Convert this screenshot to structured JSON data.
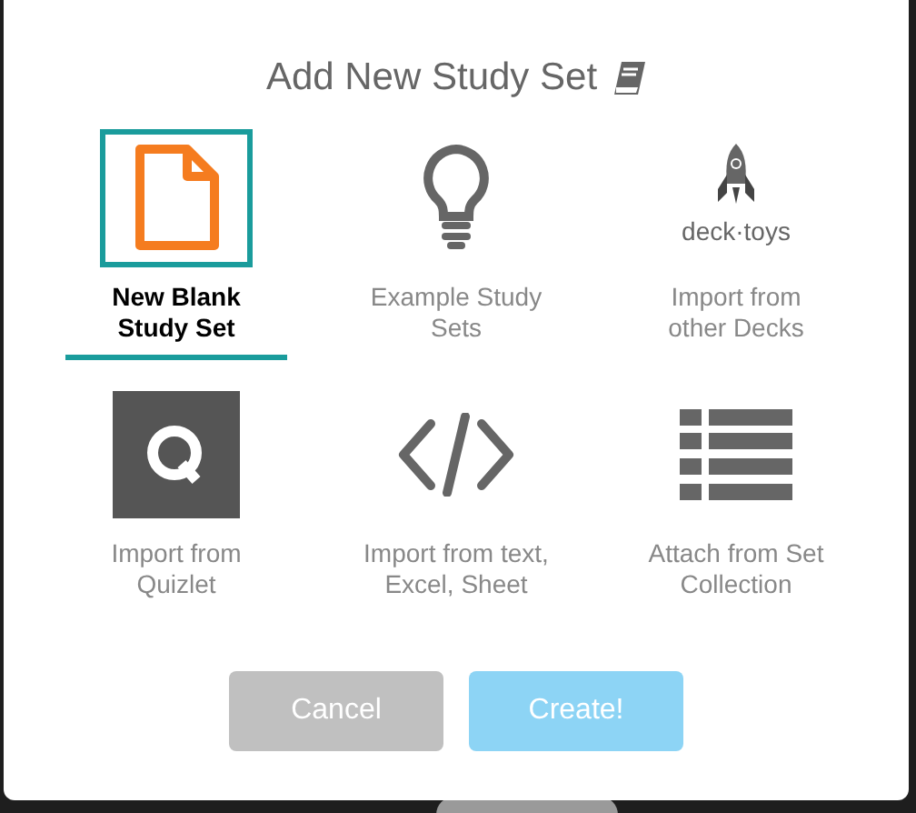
{
  "dialog": {
    "title": "Add New Study Set"
  },
  "options": [
    {
      "label": "New Blank Study Set",
      "kind": "blank",
      "selected": true
    },
    {
      "label": "Example Study Sets",
      "kind": "examples",
      "selected": false
    },
    {
      "label": "Import from other Decks",
      "kind": "decks",
      "logo_text": "deck·toys",
      "selected": false
    },
    {
      "label": "Import from Quizlet",
      "kind": "quizlet",
      "selected": false
    },
    {
      "label": "Import from text, Excel, Sheet",
      "kind": "text",
      "selected": false
    },
    {
      "label": "Attach from Set Collection",
      "kind": "collection",
      "selected": false
    }
  ],
  "buttons": [
    {
      "label": "Cancel",
      "kind": "cancel"
    },
    {
      "label": "Create!",
      "kind": "primary"
    }
  ]
}
